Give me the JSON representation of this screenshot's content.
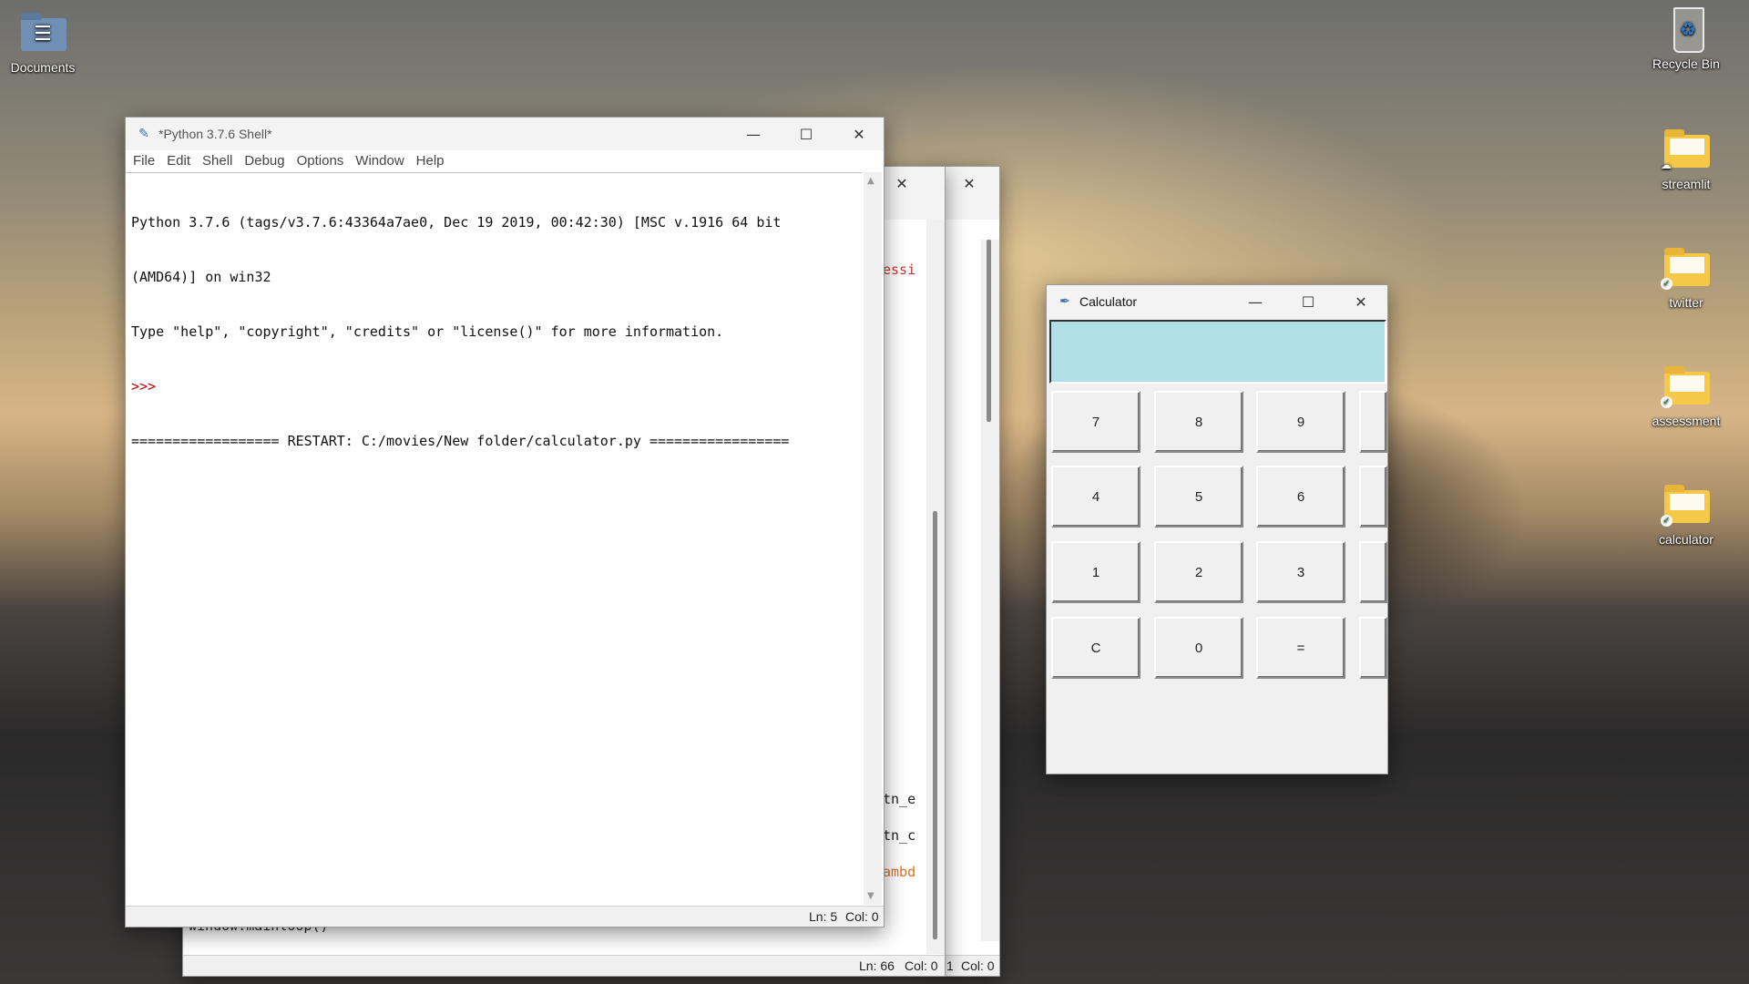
{
  "desktop": {
    "left_icons": [
      {
        "label": "Documents",
        "icon": "documents-folder-icon"
      }
    ],
    "right_icons": [
      {
        "label": "Recycle Bin",
        "icon": "recycle-bin-icon"
      },
      {
        "label": "streamlit",
        "icon": "folder-icon",
        "badge": "cloud"
      },
      {
        "label": "twitter",
        "icon": "folder-icon",
        "badge": "synced"
      },
      {
        "label": "assessment",
        "icon": "folder-icon",
        "badge": "synced"
      },
      {
        "label": "calculator",
        "icon": "folder-icon",
        "badge": "synced"
      }
    ]
  },
  "back_editor": {
    "code_fragments": [
      "essi",
      "tn_e",
      "tn_c",
      "ambd",
      "window.mainloop()"
    ],
    "status": {
      "ln": "Ln: 66",
      "col": "Col: 0"
    },
    "back_status": {
      "ln": "1",
      "col": "Col: 0"
    }
  },
  "shell": {
    "title": "*Python 3.7.6 Shell*",
    "menu": [
      "File",
      "Edit",
      "Shell",
      "Debug",
      "Options",
      "Window",
      "Help"
    ],
    "lines": [
      "Python 3.7.6 (tags/v3.7.6:43364a7ae0, Dec 19 2019, 00:42:30) [MSC v.1916 64 bit",
      "(AMD64)] on win32",
      "Type \"help\", \"copyright\", \"credits\" or \"license()\" for more information."
    ],
    "prompt": ">>>",
    "restart_line": "================== RESTART: C:/movies/New folder/calculator.py =================",
    "status": {
      "ln": "Ln: 5",
      "col": "Col: 0"
    }
  },
  "calculator": {
    "title": "Calculator",
    "display_value": "",
    "buttons": [
      [
        "7",
        "8",
        "9"
      ],
      [
        "4",
        "5",
        "6"
      ],
      [
        "1",
        "2",
        "3"
      ],
      [
        "C",
        "0",
        "="
      ]
    ]
  },
  "colors": {
    "display_bg": "#b0e0e6",
    "prompt": "#c00000",
    "code_orange": "#e07020",
    "code_red": "#d03030"
  }
}
